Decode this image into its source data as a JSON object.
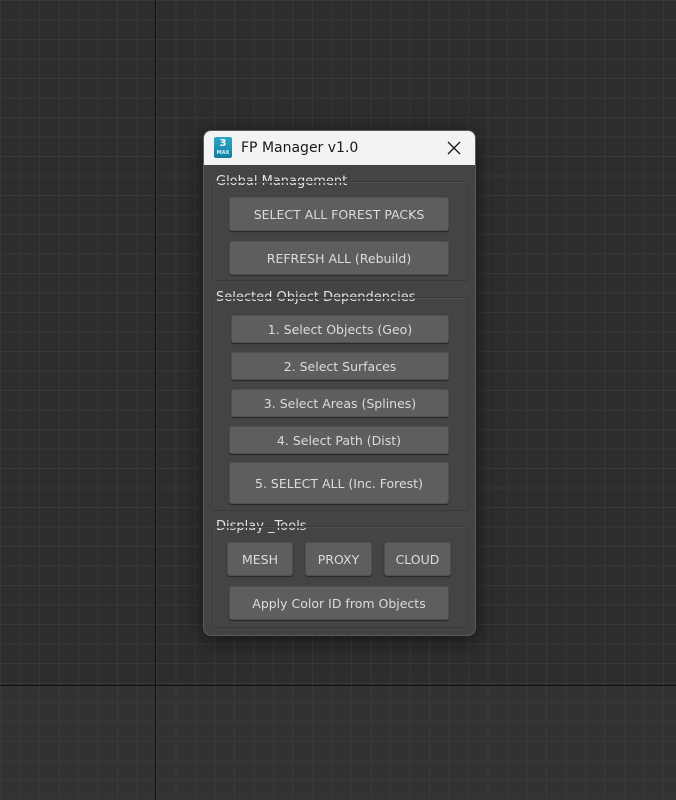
{
  "window": {
    "title": "FP Manager v1.0",
    "icon": {
      "name": "3ds-max-app-icon",
      "number": "3",
      "label": "MAX",
      "color": "#1f8fb3"
    }
  },
  "groups": {
    "global": {
      "label": "Global Management",
      "buttons": {
        "select_all_forest_packs": "SELECT ALL FOREST PACKS",
        "refresh_all": "REFRESH ALL (Rebuild)"
      }
    },
    "dependencies": {
      "label": "Selected Object Dependencies",
      "buttons": {
        "select_objects": "1. Select Objects (Geo)",
        "select_surfaces": "2. Select Surfaces",
        "select_areas": "3. Select Areas (Splines)",
        "select_path": "4. Select Path (Dist)",
        "select_all": "5. SELECT ALL (Inc. Forest)"
      }
    },
    "display": {
      "label": "Display _Tools",
      "buttons": {
        "mesh": "MESH",
        "proxy": "PROXY",
        "cloud": "CLOUD",
        "apply_color_id": "Apply Color ID from Objects"
      }
    }
  }
}
